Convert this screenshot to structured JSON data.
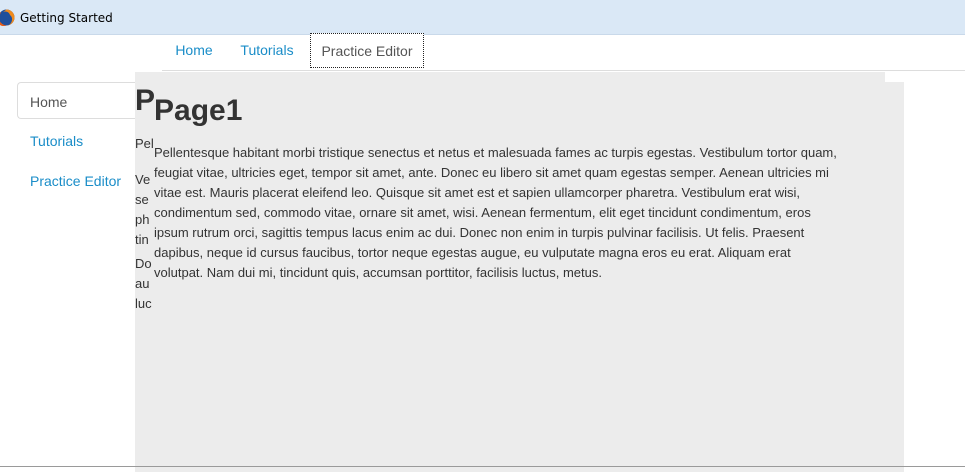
{
  "window": {
    "title": "Getting Started",
    "icon": "firefox-icon"
  },
  "top_nav": {
    "tabs": [
      {
        "label": "Home"
      },
      {
        "label": "Tutorials"
      },
      {
        "label": "Practice Editor"
      }
    ]
  },
  "side_nav": {
    "items": [
      {
        "label": "Home"
      },
      {
        "label": "Tutorials"
      },
      {
        "label": "Practice Editor"
      }
    ]
  },
  "underlay": {
    "heading": "P",
    "lines": [
      "Pel",
      "Ve",
      "se",
      "ph",
      "tin",
      "Do",
      "au",
      "luc"
    ]
  },
  "content": {
    "heading": "Page1",
    "lines": [
      "Pellentesque habitant morbi tristique senectus et netus et malesuada fames ac turpis egestas. Vestibulum tortor quam,",
      "feugiat vitae, ultricies eget, tempor sit amet, ante. Donec eu libero sit amet quam egestas semper. Aenean ultricies mi",
      "vitae est. Mauris placerat eleifend leo. Quisque sit amet est et sapien ullamcorper pharetra. Vestibulum erat wisi,",
      "condimentum sed, commodo vitae, ornare sit amet, wisi. Aenean fermentum, elit eget tincidunt condimentum, eros",
      "ipsum rutrum orci, sagittis tempus lacus enim ac dui. Donec non enim in turpis pulvinar facilisis. Ut felis. Praesent",
      "dapibus, neque id cursus faucibus, tortor neque egestas augue, eu vulputate magna eros eu erat. Aliquam erat",
      "volutpat. Nam dui mi, tincidunt quis, accumsan porttitor, facilisis luctus, metus."
    ]
  }
}
